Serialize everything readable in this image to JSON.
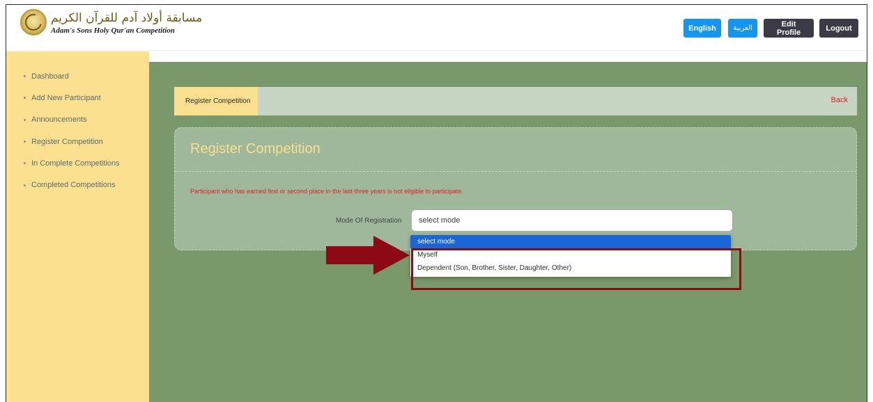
{
  "header": {
    "logo_arabic": "مسابقة أولاد آدم للقرآن الكريم",
    "logo_english": "Adam's Sons Holy Qur'an Competition",
    "buttons": {
      "english": "English",
      "arabic": "العربية",
      "edit_profile": "Edit Profile",
      "logout": "Logout"
    }
  },
  "sidebar": {
    "items": [
      {
        "label": "Dashboard"
      },
      {
        "label": "Add New Participant"
      },
      {
        "label": "Announcements"
      },
      {
        "label": "Register Competition"
      },
      {
        "label": "In Complete Competitions"
      },
      {
        "label": "Completed Competitions"
      }
    ]
  },
  "breadcrumb": {
    "current": "Register Competition",
    "back": "Back"
  },
  "form": {
    "title": "Register Competition",
    "notice": "Participant who has earned first or second place in the last three years is not eligible to participate.",
    "mode_label": "Mode Of Registration",
    "mode_value": "select mode",
    "options": [
      "select mode",
      "Myself",
      "Dependent (Son, Brother, Sister, Daughter, Other)"
    ]
  },
  "colors": {
    "sidebar_bg": "#fbe08f",
    "main_bg": "#7a996b",
    "accent_blue": "#1496f0",
    "dark_button": "#3b3b48",
    "annotation": "#8b0a16",
    "notice_red": "#e32020"
  }
}
